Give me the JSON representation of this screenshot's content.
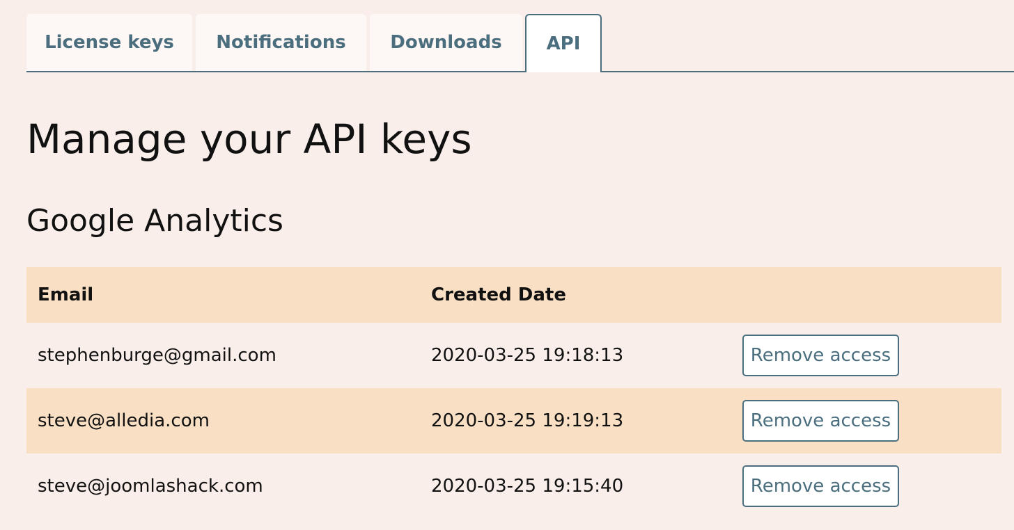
{
  "tabs": [
    {
      "label": "License keys",
      "active": false
    },
    {
      "label": "Notifications",
      "active": false
    },
    {
      "label": "Downloads",
      "active": false
    },
    {
      "label": "API",
      "active": true
    }
  ],
  "page_title": "Manage your API keys",
  "section_title": "Google Analytics",
  "table": {
    "headers": {
      "email": "Email",
      "created_date": "Created Date",
      "action": ""
    },
    "rows": [
      {
        "email": "stephenburge@gmail.com",
        "created_date": "2020-03-25 19:18:13",
        "action_label": "Remove access"
      },
      {
        "email": "steve@alledia.com",
        "created_date": "2020-03-25 19:19:13",
        "action_label": "Remove access"
      },
      {
        "email": "steve@joomlashack.com",
        "created_date": "2020-03-25 19:15:40",
        "action_label": "Remove access"
      }
    ]
  },
  "colors": {
    "background": "#f9eee9",
    "accent": "#4a6e7e",
    "row_highlight": "#f9dfc4",
    "tab_background": "#fdf8f5"
  }
}
